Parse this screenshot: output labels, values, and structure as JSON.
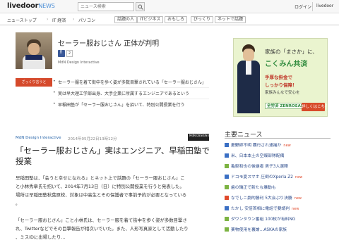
{
  "header": {
    "logo_main": "livedoor",
    "logo_sub": "NEWS",
    "search_placeholder": "ニュース検索",
    "login": "ログイン",
    "brand_link": "livedoor"
  },
  "nav": {
    "items": [
      "ニューストップ",
      "IT 経済",
      "パソコン"
    ],
    "chips": [
      "話題の人",
      "ITビジネス",
      "おもしろ",
      "びっくり",
      "ネットで話題"
    ]
  },
  "article": {
    "headline": "セーラー服おじさん 正体が判明",
    "fb_label": "f",
    "fb_count": "2",
    "source_line": "MdN Design Interactive",
    "summary_label": "ざっくり言うと",
    "summary": [
      "セーラー服を着て街中を歩く姿が多数目撃されている「セーラー服おじさん」",
      "実は早大理工学部出身、大手企業に所属するエンジニアであるという",
      "早稲田塾が「セーラー服おじさん」を招いて、特別公開授業を行う"
    ],
    "meta_source": "MdN Design Interactive",
    "meta_date": "2014年05月22日13時12分",
    "meta_logo": "MdN DESIGN INTERACTIVE",
    "title": "「セーラー服おじさん」実はエンジニア、早稲田塾で授業",
    "para1": [
      "早稲田塾は、「会うと幸せになれる」とネット上で話題の「セーラー服おじさん」こ",
      "と小林秀章氏を招いて、2014年7月13日（日）に特別公開授業を行うと発表した。",
      "場所は早稲田塾秋葉原校、対象は中高生とその保護者で事前予約が必要となっている",
      "。"
    ],
    "para2": [
      "「セーラー服おじさん」こと小林氏は、セーラー服を着て街中を歩く姿が多数目撃さ",
      "れ、Twitterなどでその目撃報告が相次いでいた。また、人形写真家として活動したり",
      "、ミスiDに出場したり…"
    ]
  },
  "ad": {
    "line1": "家族の「まさか」に、",
    "line2": "こくみん共済",
    "line3": "手厚な掛金で",
    "line4": "しっかり保障！",
    "line5": "家族みんなで安心を",
    "logo": "全労済 ZENROSAI",
    "button": "詳しくはこちら"
  },
  "sidebar": {
    "heading": "主要ニュース",
    "items": [
      {
        "text": "憂鬱師不明 覇行され逮捕か",
        "bullet": "#3a6fc4",
        "new": true
      },
      {
        "text": "米、日本本土の空爆部隊配備",
        "bullet": "#3a6fc4",
        "new": false
      },
      {
        "text": "亀梨和也の後継者 男子3人選陣",
        "bullet": "#7cb342",
        "new": false
      },
      {
        "text": "ドコモ夏スマホ 圧倒のXperia Z2",
        "bullet": "#3a6fc4",
        "new": true
      },
      {
        "text": "歯の矯正で新たな暴動も",
        "bullet": "#7cb342",
        "new": false
      },
      {
        "text": "なでしこ劇的勝利 5大会ぶり決勝",
        "bullet": "#e0492b",
        "new": true
      },
      {
        "text": "たかし 安倍首相に電話で要請判",
        "bullet": "#3a6fc4",
        "new": true
      },
      {
        "text": "ダウンタウン番組 100枚が有料NG",
        "bullet": "#7cb342",
        "new": false
      },
      {
        "text": "薬物使用を裏論…ASKAの家族",
        "bullet": "#7cb342",
        "new": false
      }
    ],
    "new_label": "new"
  }
}
